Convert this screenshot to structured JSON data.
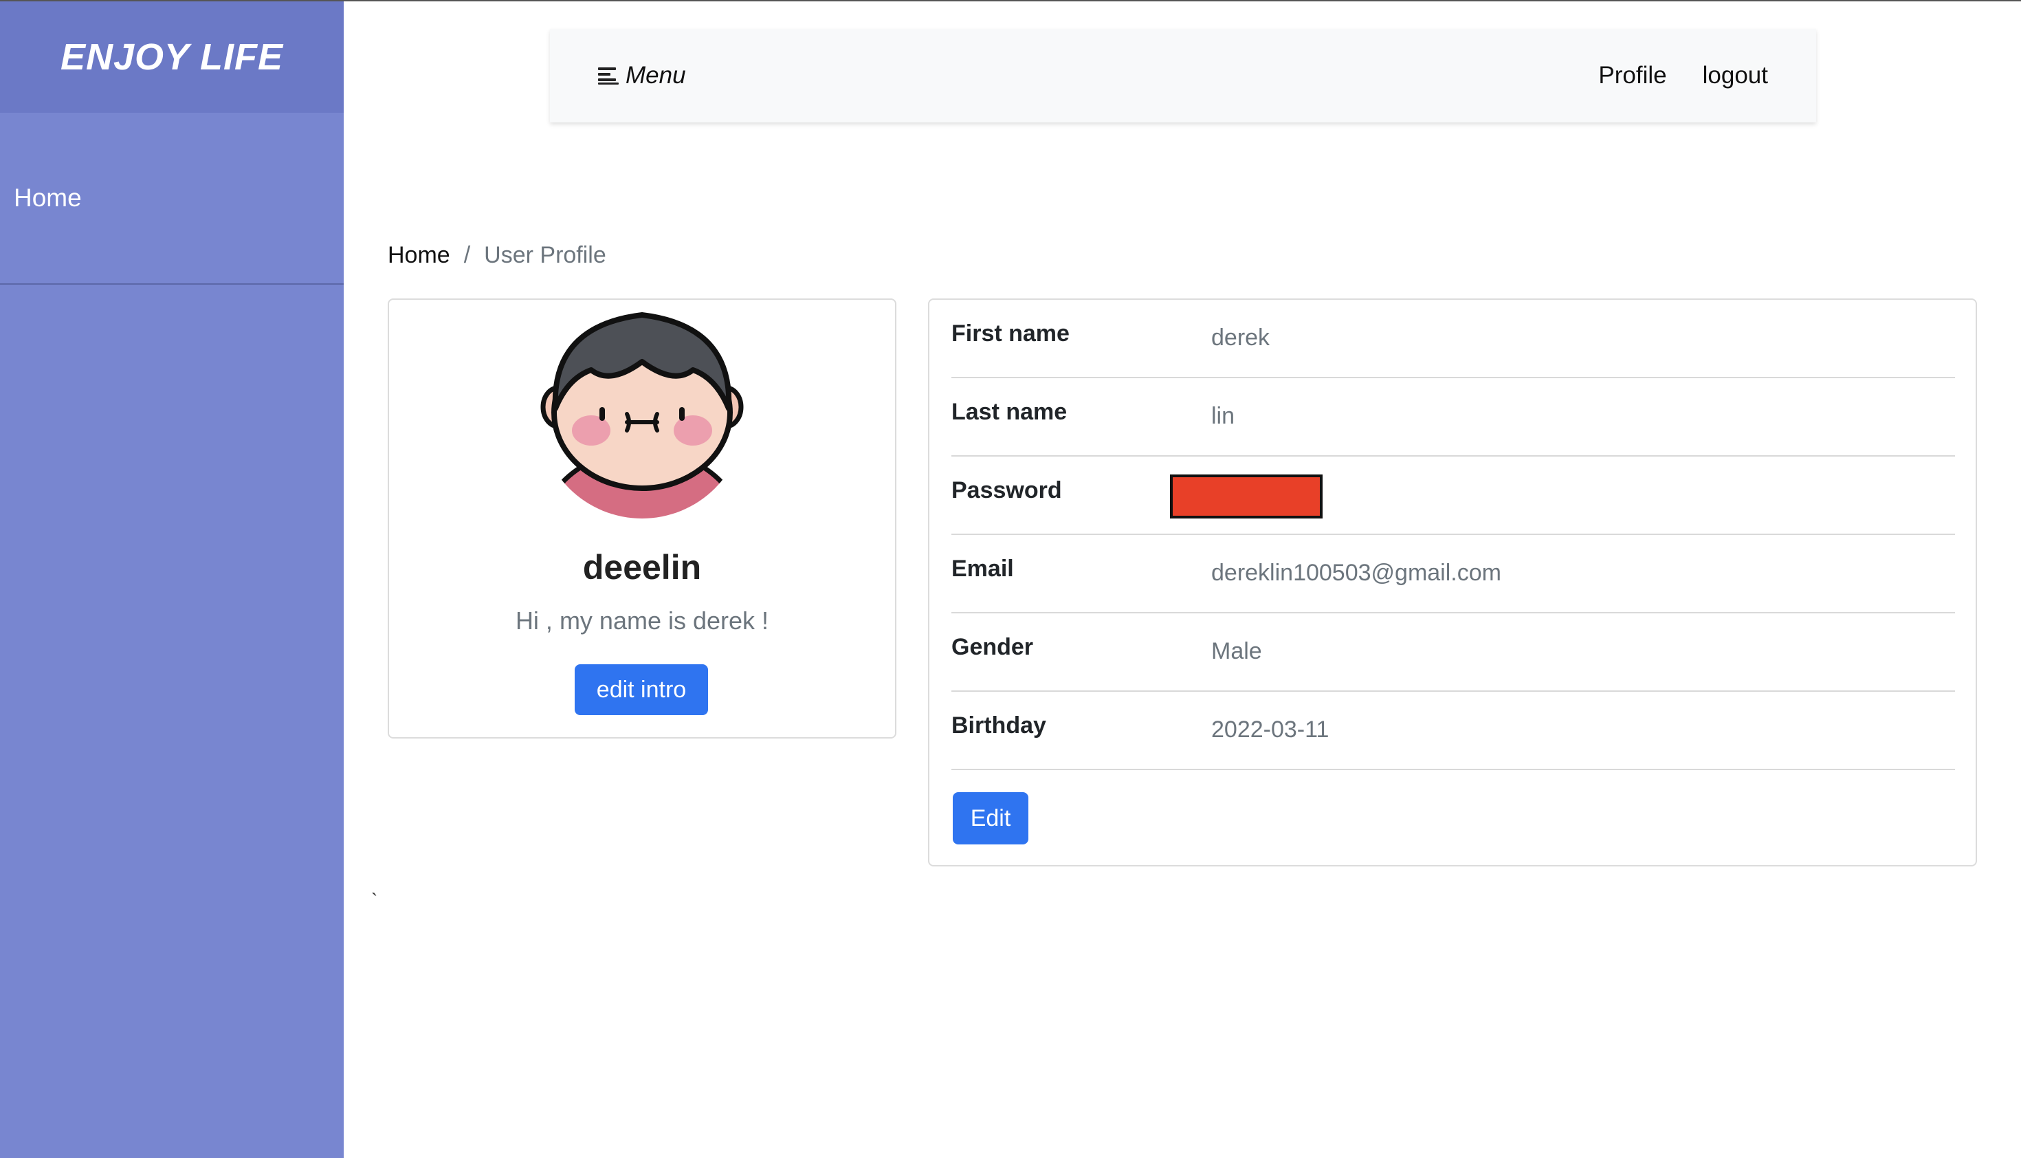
{
  "sidebar": {
    "brand": "ENJOY LIFE",
    "items": [
      {
        "label": "Home"
      }
    ]
  },
  "navbar": {
    "menu_label": "Menu",
    "links": [
      {
        "label": "Profile"
      },
      {
        "label": "logout"
      }
    ]
  },
  "breadcrumb": {
    "home": "Home",
    "separator": "/",
    "current": "User Profile"
  },
  "profile_card": {
    "username": "deeelin",
    "intro": "Hi , my name is derek !",
    "edit_intro_label": "edit intro"
  },
  "details": {
    "rows": [
      {
        "label": "First name",
        "value": "derek"
      },
      {
        "label": "Last name",
        "value": "lin"
      },
      {
        "label": "Password",
        "value": ""
      },
      {
        "label": "Email",
        "value": "dereklin100503@gmail.com"
      },
      {
        "label": "Gender",
        "value": "Male"
      },
      {
        "label": "Birthday",
        "value": "2022-03-11"
      }
    ],
    "edit_label": "Edit"
  },
  "stray_mark": "`",
  "colors": {
    "sidebar": "#7886d0",
    "sidebar_brand": "#6b79c6",
    "primary_button": "#2f74f0",
    "password_redaction": "#e84028"
  }
}
